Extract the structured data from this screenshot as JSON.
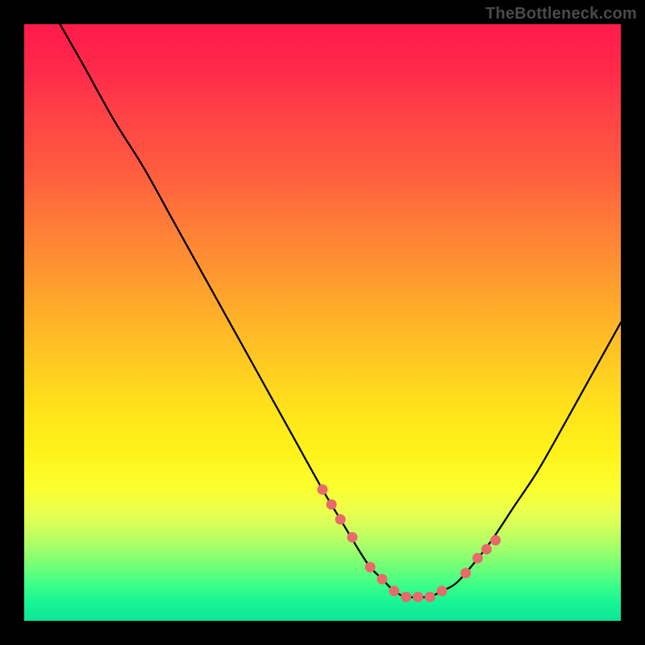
{
  "attribution": "TheBottleneck.com",
  "colors": {
    "page_bg": "#000000",
    "curve_stroke": "#000000",
    "marker_fill": "#e86a6a",
    "gradient_top": "#ff1a4b",
    "gradient_bottom": "#0de59a"
  },
  "chart_data": {
    "type": "line",
    "title": "",
    "xlabel": "",
    "ylabel": "",
    "xlim": [
      0,
      100
    ],
    "ylim": [
      0,
      100
    ],
    "grid": false,
    "legend": false,
    "series": [
      {
        "name": "bottleneck-curve",
        "x": [
          6,
          10,
          15,
          20,
          25,
          30,
          35,
          40,
          45,
          50,
          53,
          56,
          58,
          60,
          62,
          64,
          66,
          68,
          70,
          72,
          74,
          78,
          82,
          86,
          90,
          95,
          100
        ],
        "y": [
          100,
          93,
          84,
          76,
          67,
          58,
          49,
          40,
          31,
          22,
          17,
          12,
          9,
          7,
          5,
          4,
          4,
          4,
          5,
          6,
          8,
          13,
          19,
          25,
          32,
          41,
          50
        ]
      }
    ],
    "markers": {
      "name": "highlight-dots",
      "x": [
        50,
        51.5,
        53,
        55,
        58,
        60,
        62,
        64,
        66,
        68,
        70,
        74,
        76,
        77.5,
        79
      ],
      "y": [
        22,
        19.5,
        17,
        14,
        9,
        7,
        5,
        4,
        4,
        4,
        5,
        8,
        10.5,
        12,
        13.5
      ]
    }
  }
}
